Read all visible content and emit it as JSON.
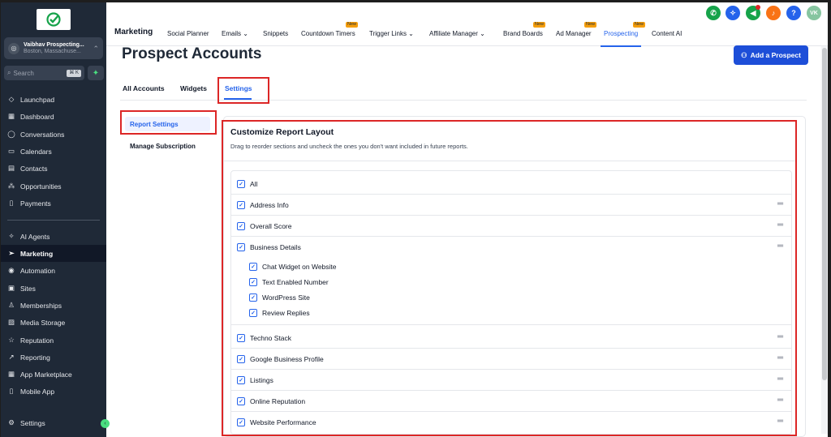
{
  "sidebar": {
    "account": {
      "name": "Vaibhav Prospecting...",
      "location": "Boston, Massachuse..."
    },
    "search": {
      "placeholder": "Search",
      "shortcut": "⌘ K"
    },
    "nav_items": [
      {
        "label": "Launchpad",
        "icon": "rocket-icon"
      },
      {
        "label": "Dashboard",
        "icon": "grid-icon"
      },
      {
        "label": "Conversations",
        "icon": "chat-icon"
      },
      {
        "label": "Calendars",
        "icon": "calendar-icon"
      },
      {
        "label": "Contacts",
        "icon": "contact-card-icon"
      },
      {
        "label": "Opportunities",
        "icon": "opportunities-icon"
      },
      {
        "label": "Payments",
        "icon": "receipt-icon"
      },
      {
        "label": "AI Agents",
        "icon": "sparkle-icon"
      },
      {
        "label": "Marketing",
        "icon": "send-icon"
      },
      {
        "label": "Automation",
        "icon": "automation-icon"
      },
      {
        "label": "Sites",
        "icon": "sites-icon"
      },
      {
        "label": "Memberships",
        "icon": "membership-icon"
      },
      {
        "label": "Media Storage",
        "icon": "image-icon"
      },
      {
        "label": "Reputation",
        "icon": "star-icon"
      },
      {
        "label": "Reporting",
        "icon": "trend-icon"
      },
      {
        "label": "App Marketplace",
        "icon": "apps-icon"
      },
      {
        "label": "Mobile App",
        "icon": "mobile-icon"
      },
      {
        "label": "Settings",
        "icon": "gear-icon"
      }
    ],
    "active_item": "Marketing"
  },
  "topnav": {
    "section": "Marketing",
    "items": [
      {
        "label": "Social Planner"
      },
      {
        "label": "Emails ⌄"
      },
      {
        "label": "Snippets"
      },
      {
        "label": "Countdown Timers",
        "badge": "New"
      },
      {
        "label": "Trigger Links ⌄"
      },
      {
        "label": "Affiliate Manager ⌄"
      },
      {
        "label": "Brand Boards",
        "badge": "New"
      },
      {
        "label": "Ad Manager",
        "badge": "New"
      },
      {
        "label": "Prospecting",
        "badge": "New"
      },
      {
        "label": "Content AI"
      }
    ],
    "active": "Prospecting",
    "user_initials": "VK",
    "help": "?"
  },
  "page": {
    "title": "Prospect Accounts",
    "add_button": "Add a Prospect",
    "tabs": [
      "All Accounts",
      "Widgets",
      "Settings"
    ],
    "active_tab": "Settings"
  },
  "settings_menu": {
    "items": [
      "Report Settings",
      "Manage Subscription"
    ],
    "active": "Report Settings"
  },
  "report_layout": {
    "title": "Customize Report Layout",
    "subtitle": "Drag to reorder sections and uncheck the ones you don't want included in future reports.",
    "all_label": "All",
    "sections": [
      {
        "label": "Address Info",
        "checked": true
      },
      {
        "label": "Overall Score",
        "checked": true
      },
      {
        "label": "Business Details",
        "checked": true,
        "children": [
          {
            "label": "Chat Widget on Website",
            "checked": true
          },
          {
            "label": "Text Enabled Number",
            "checked": true
          },
          {
            "label": "WordPress Site",
            "checked": true
          },
          {
            "label": "Review Replies",
            "checked": true
          }
        ]
      },
      {
        "label": "Techno Stack",
        "checked": true
      },
      {
        "label": "Google Business Profile",
        "checked": true
      },
      {
        "label": "Listings",
        "checked": true
      },
      {
        "label": "Online Reputation",
        "checked": true
      },
      {
        "label": "Website Performance",
        "checked": true
      }
    ]
  },
  "colors": {
    "accent": "#2563eb",
    "sidebar": "#1f2937",
    "highlight": "#dc2626"
  }
}
